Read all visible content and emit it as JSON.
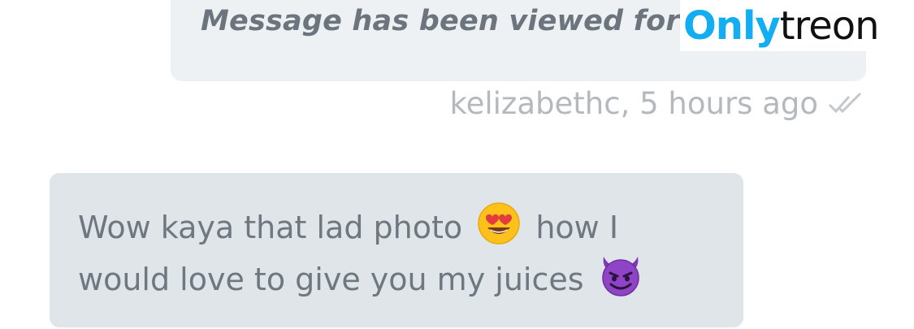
{
  "outgoing_message": {
    "text": "Message has been viewed for $"
  },
  "watermark": {
    "part1": "Only",
    "part2": "treon"
  },
  "meta": {
    "sender_time": "kelizabethc, 5 hours ago",
    "read_icon": "double-check-icon"
  },
  "incoming_message": {
    "segment1": "Wow kaya that lad photo",
    "emoji1": "heart-eyes-emoji",
    "segment2": "how I",
    "segment3": "would love to give you my juices",
    "emoji2": "smiling-devil-emoji"
  },
  "colors": {
    "outgoing_bubble": "#eef1f4",
    "incoming_bubble": "#dfe5e9",
    "meta_text": "#b3b9be",
    "watermark_blue": "#12aef1"
  }
}
